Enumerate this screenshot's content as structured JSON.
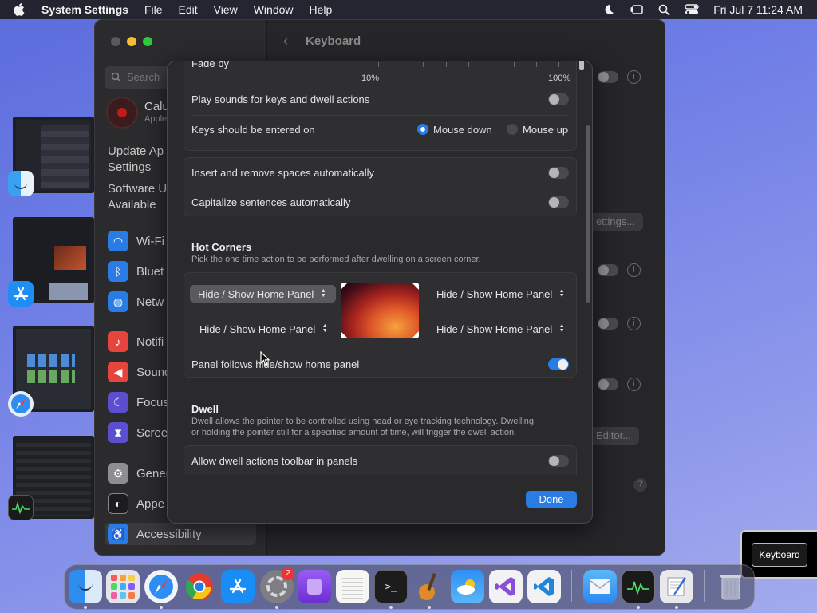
{
  "menubar": {
    "app_name": "System Settings",
    "items": [
      "File",
      "Edit",
      "View",
      "Window",
      "Help"
    ],
    "datetime": "Fri Jul 7  11:24 AM"
  },
  "settings_window": {
    "title": "Keyboard",
    "search_placeholder": "Search",
    "profile_name": "Calu",
    "profile_sub": "Apple",
    "update_line1": "Update Ap",
    "update_line2": "Settings",
    "software_line1": "Software U",
    "software_line2": "Available",
    "sidebar": [
      {
        "label": "Wi-Fi",
        "icon": "wifi-icon",
        "color": "#2a7ce5"
      },
      {
        "label": "Bluet",
        "icon": "bluetooth-icon",
        "color": "#2a7ce5"
      },
      {
        "label": "Netw",
        "icon": "globe-icon",
        "color": "#2a7ce5"
      },
      {
        "label": "Notifi",
        "icon": "bell-icon",
        "color": "#e5453b"
      },
      {
        "label": "Sound",
        "icon": "speaker-icon",
        "color": "#e5453b"
      },
      {
        "label": "Focus",
        "icon": "moon-icon",
        "color": "#5b4fd0"
      },
      {
        "label": "Scree",
        "icon": "hourglass-icon",
        "color": "#5b4fd0"
      },
      {
        "label": "Gener",
        "icon": "gear-icon",
        "color": "#8e8e92"
      },
      {
        "label": "Appe",
        "icon": "appearance-icon",
        "color": "#1c1c1e"
      },
      {
        "label": "Accessibility",
        "icon": "accessibility-icon",
        "color": "#2a7ce5"
      }
    ],
    "bg_button_settings": "ettings...",
    "bg_button_editor": "Editor..."
  },
  "sheet": {
    "fade_by_label": "Fade by",
    "slider_min": "10%",
    "slider_max": "100%",
    "slider_value_percent": 100,
    "play_sounds_label": "Play sounds for keys and dwell actions",
    "play_sounds_on": false,
    "keys_entered_label": "Keys should be entered on",
    "mouse_down_label": "Mouse down",
    "mouse_up_label": "Mouse up",
    "keys_entered_selected": "Mouse down",
    "insert_spaces_label": "Insert and remove spaces automatically",
    "insert_spaces_on": false,
    "capitalize_label": "Capitalize sentences automatically",
    "capitalize_on": false,
    "hot_corners_title": "Hot Corners",
    "hot_corners_desc": "Pick the one time action to be performed after dwelling on a screen corner.",
    "corner_top_left": "Hide / Show Home Panel",
    "corner_top_right": "Hide / Show Home Panel",
    "corner_bottom_left": "Hide / Show Home Panel",
    "corner_bottom_right": "Hide / Show Home Panel",
    "panel_follows_label": "Panel follows hide/show home panel",
    "panel_follows_on": true,
    "dwell_title": "Dwell",
    "dwell_desc_line1": "Dwell allows the pointer to be controlled using head or eye tracking technology. Dwelling,",
    "dwell_desc_line2": "or holding the pointer still for a specified amount of time, will trigger the dwell action.",
    "dwell_toolbar_label": "Allow dwell actions toolbar in panels",
    "dwell_toolbar_on": false,
    "done_label": "Done"
  },
  "tooltip": {
    "label": "Keyboard"
  },
  "dock": {
    "settings_badge": "2",
    "apps": [
      "finder-icon",
      "launchpad-icon",
      "safari-icon",
      "chrome-icon",
      "app-store-icon",
      "system-settings-icon",
      "podcasts-icon",
      "textedit-icon",
      "terminal-icon",
      "garageband-icon",
      "weather-icon",
      "visual-studio-icon",
      "vscode-icon",
      "mail-icon",
      "activity-monitor-icon",
      "script-editor-icon",
      "trash-icon"
    ]
  }
}
